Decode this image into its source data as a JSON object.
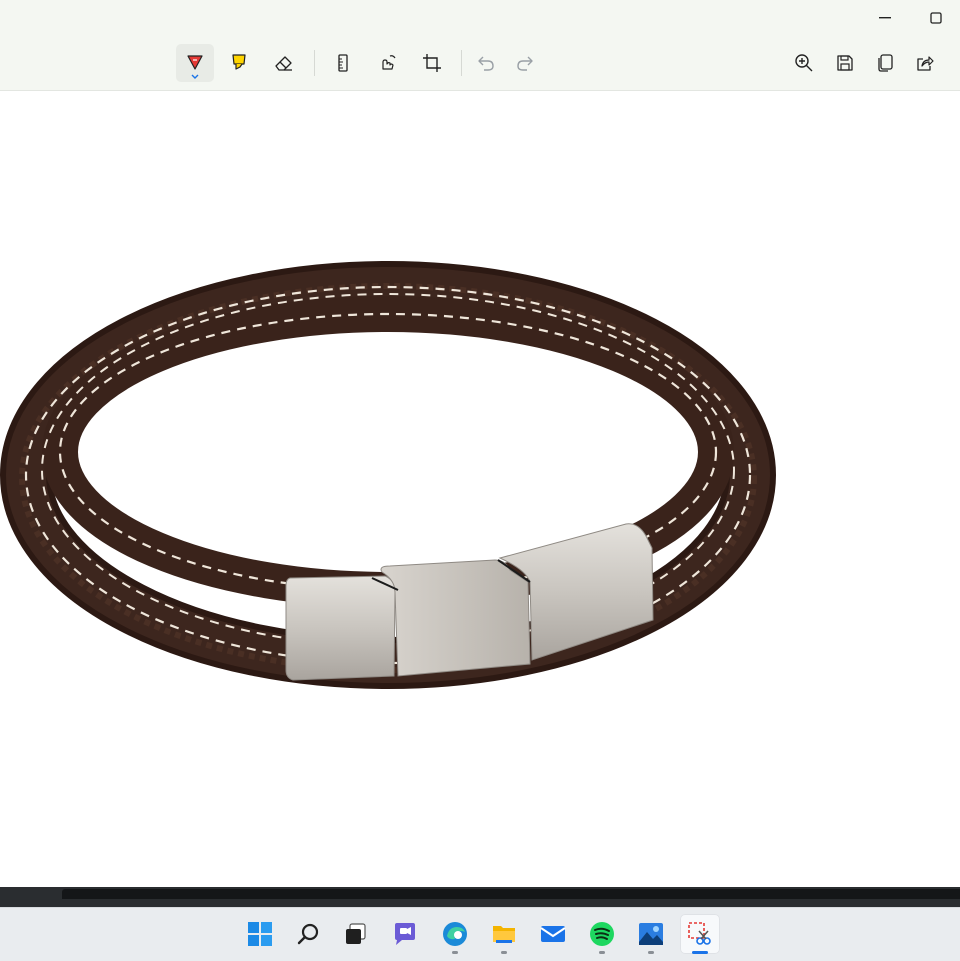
{
  "window": {
    "app": "Snipping Tool",
    "controls": [
      "minimize-icon",
      "maximize-icon"
    ]
  },
  "toolbar": {
    "tools": [
      {
        "name": "ballpoint-pen",
        "icon": "pen-icon",
        "active": true,
        "color": "#d32f2f"
      },
      {
        "name": "highlighter",
        "icon": "highlighter-icon",
        "color": "#f5c400"
      },
      {
        "name": "eraser",
        "icon": "eraser-icon"
      },
      {
        "name": "ruler",
        "icon": "ruler-icon"
      },
      {
        "name": "touch-writing",
        "icon": "touch-writing-icon"
      },
      {
        "name": "crop",
        "icon": "crop-icon"
      },
      {
        "name": "undo",
        "icon": "undo-icon",
        "enabled": false
      },
      {
        "name": "redo",
        "icon": "redo-icon",
        "enabled": false
      },
      {
        "name": "zoom",
        "icon": "zoom-in-icon"
      },
      {
        "name": "save",
        "icon": "save-icon"
      },
      {
        "name": "copy",
        "icon": "copy-icon"
      },
      {
        "name": "share",
        "icon": "share-icon"
      }
    ]
  },
  "canvas": {
    "content": "leather-bracelet-photo",
    "colors": {
      "leather": "#3a231c",
      "stitch": "#efe6da",
      "clasp": "#c9c5bf"
    }
  },
  "taskbar": {
    "apps": [
      {
        "icon": "windows-start-icon"
      },
      {
        "icon": "search-icon"
      },
      {
        "icon": "task-view-icon"
      },
      {
        "icon": "teams-chat-icon"
      },
      {
        "icon": "edge-icon",
        "running": true
      },
      {
        "icon": "file-explorer-icon",
        "running": true
      },
      {
        "icon": "mail-icon"
      },
      {
        "icon": "spotify-icon",
        "running": true
      },
      {
        "icon": "photos-icon",
        "running": true
      },
      {
        "icon": "snipping-tool-icon",
        "running": true,
        "active": true
      }
    ]
  }
}
